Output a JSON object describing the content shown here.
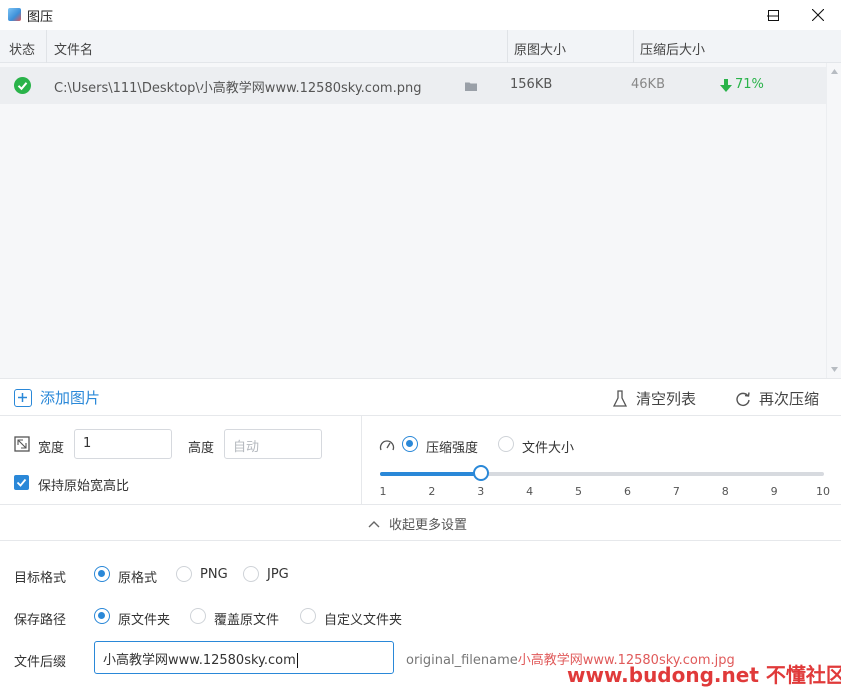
{
  "window": {
    "title": "图压"
  },
  "table": {
    "headers": {
      "status": "状态",
      "filename": "文件名",
      "original_size": "原图大小",
      "compressed_size": "压缩后大小"
    },
    "rows": [
      {
        "status_icon": "check-circle-icon",
        "filename": "C:\\Users\\111\\Desktop\\小高教学网www.12580sky.com.png",
        "original_size": "156KB",
        "compressed_size": "46KB",
        "reduction": "71%"
      }
    ]
  },
  "toolbar": {
    "add_label": "添加图片",
    "clear_label": "清空列表",
    "recompress_label": "再次压缩"
  },
  "size": {
    "width_label": "宽度",
    "width_value": "1",
    "height_label": "高度",
    "height_placeholder": "自动",
    "keep_ratio_label": "保持原始宽高比",
    "keep_ratio_checked": true
  },
  "compression": {
    "mode_strength_label": "压缩强度",
    "mode_size_label": "文件大小",
    "selected_mode": "strength",
    "slider_min": 1,
    "slider_max": 10,
    "slider_value": 3,
    "ticks": [
      "1",
      "2",
      "3",
      "4",
      "5",
      "6",
      "7",
      "8",
      "9",
      "10"
    ]
  },
  "collapse_label": "收起更多设置",
  "format": {
    "label": "目标格式",
    "options": [
      "原格式",
      "PNG",
      "JPG"
    ],
    "selected": "原格式"
  },
  "save_path": {
    "label": "保存路径",
    "options": [
      "原文件夹",
      "覆盖原文件",
      "自定义文件夹"
    ],
    "selected": "原文件夹"
  },
  "suffix": {
    "label": "文件后缀",
    "value": "小高教学网www.12580sky.com",
    "preview_prefix": "original_filename",
    "preview_suffix": "小高教学网www.12580sky.com.jpg"
  },
  "watermark": "www.budong.net 不懂社区",
  "colors": {
    "accent": "#2a88d8",
    "success": "#2ab34a",
    "watermark": "#e03a3a"
  }
}
